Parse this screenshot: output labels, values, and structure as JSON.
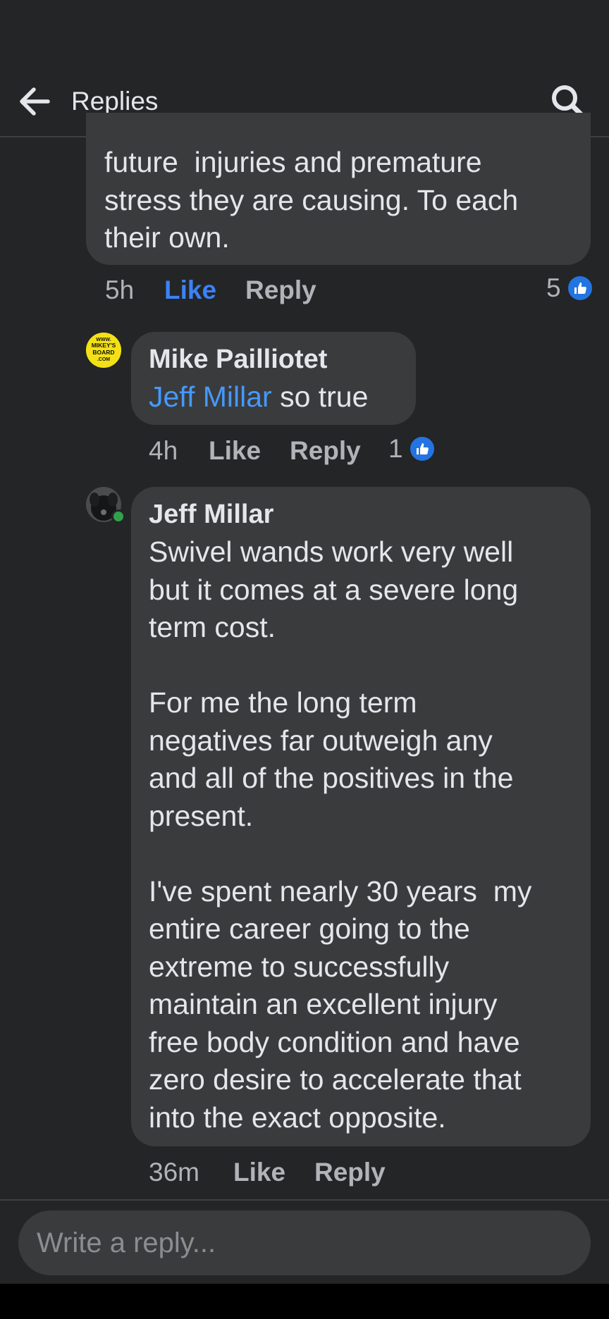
{
  "header": {
    "title": "Replies"
  },
  "comment_top": {
    "text": "future  injuries and premature\nstress they are causing. To each\ntheir own.",
    "time": "5h",
    "like_label": "Like",
    "reply_label": "Reply",
    "reaction_count": "5"
  },
  "comment_mike": {
    "author": "Mike Pailliotet",
    "avatar_text": "WWW. MIKEY'S BOARD .COM",
    "mention": "Jeff Millar",
    "text": " so true",
    "time": "4h",
    "like_label": "Like",
    "reply_label": "Reply",
    "reaction_count": "1"
  },
  "comment_jeff": {
    "author": "Jeff Millar",
    "text": "Swivel wands work very well\nbut it comes at a severe long\nterm cost.\n\nFor me the long term\nnegatives far outweigh any\nand all of the positives in the\npresent.\n\nI've spent nearly 30 years  my\nentire career going to the\nextreme to successfully\nmaintain an excellent injury\nfree body condition and have\nzero desire to accelerate that\ninto the exact opposite.",
    "time": "36m",
    "like_label": "Like",
    "reply_label": "Reply"
  },
  "composer": {
    "placeholder": "Write a reply..."
  },
  "colors": {
    "background": "#242526",
    "bubble": "#3a3b3c",
    "accent": "#3b82f6",
    "mention": "#4599ff",
    "secondary_text": "#b0b3b8"
  }
}
